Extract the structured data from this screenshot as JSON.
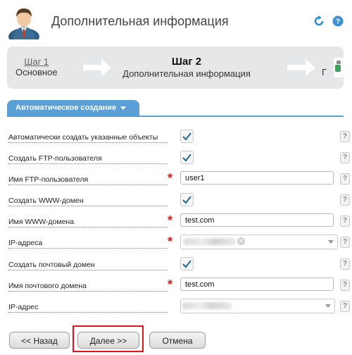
{
  "header": {
    "title": "Дополнительная информация",
    "icons": [
      "user-avatar-icon",
      "refresh-icon",
      "help-icon"
    ]
  },
  "wizard": {
    "step1": {
      "number": "Шаг 1",
      "name": "Основное"
    },
    "step2": {
      "number": "Шаг 2",
      "name": "Дополнительная информация"
    },
    "step3_partial": "Г"
  },
  "section": {
    "tab_label": "Автоматическое создание"
  },
  "form": {
    "auto_create_label": "Автоматически создать указанные объекты",
    "create_ftp_label": "Создать FTP-пользователя",
    "ftp_user_label": "Имя FTP-пользователя",
    "ftp_user_value": "user1",
    "create_www_label": "Создать WWW-домен",
    "www_domain_label": "Имя WWW-домена",
    "www_domain_value": "test.com",
    "ip_addresses_label": "IP-адреса",
    "create_mail_label": "Создать почтовый домен",
    "mail_domain_label": "Имя почтового домена",
    "mail_domain_value": "test.com",
    "ip_address_label": "IP-адрес",
    "required_mark": "*",
    "help_mark": "?"
  },
  "buttons": {
    "back": "<< Назад",
    "next": "Далее >>",
    "cancel": "Отмена"
  },
  "colors": {
    "accent": "#5a9fd6",
    "required": "#d81f1f",
    "highlight": "#e0141c",
    "check": "#2d6f9a"
  }
}
